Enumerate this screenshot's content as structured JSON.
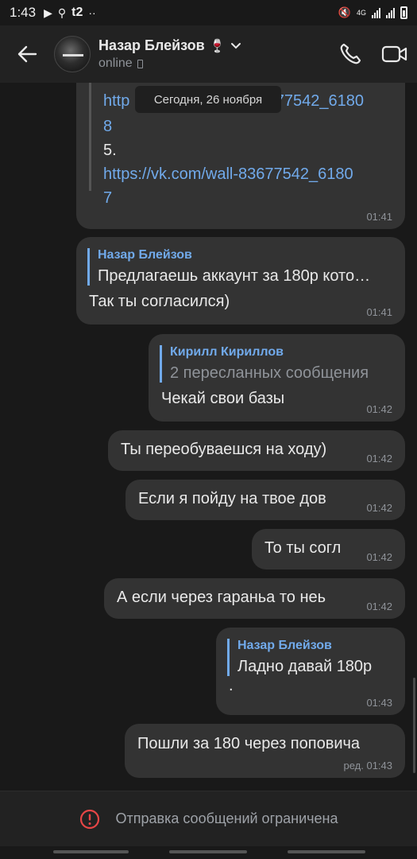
{
  "status_bar": {
    "time": "1:43",
    "carrier": "t2",
    "network": "4G",
    "dots": "··"
  },
  "header": {
    "contact_name": "Назар Блейзов",
    "emoji": "🍷",
    "status": "online"
  },
  "date_divider": "Сегодня, 26 ноября",
  "messages": [
    {
      "from": "them",
      "link_partial_1": "http",
      "link_partial_1b": "83677542_6180",
      "link_partial_2": "8",
      "list_num": "5.",
      "link_line_1": "https://vk.com/wall-83677542_6180",
      "link_line_2": "7",
      "time": "01:41"
    },
    {
      "from": "them",
      "reply_name": "Назар Блейзов",
      "reply_text": "Предлагаешь аккаунт за 180р кото…",
      "text": "Так ты согласился)",
      "time": "01:41"
    },
    {
      "from": "me",
      "reply_name": "Кирилл Кириллов",
      "reply_text": "2 пересланных сообщения",
      "text": "Чекай свои базы",
      "time": "01:42"
    },
    {
      "from": "me",
      "text": "Ты переобуваешся на ходу)",
      "time": "01:42"
    },
    {
      "from": "me",
      "text": "Если я пойду на твое дов",
      "time": "01:42"
    },
    {
      "from": "me",
      "text": "То ты согл",
      "time": "01:42"
    },
    {
      "from": "me",
      "text": "А если через гараньа то неь",
      "time": "01:42"
    },
    {
      "from": "me",
      "reply_name": "Назар Блейзов",
      "reply_text": "Ладно давай 180р",
      "text": ".",
      "time": "01:43"
    },
    {
      "from": "me",
      "text": "Пошли за 180 через поповича",
      "time": "ред. 01:43"
    }
  ],
  "restriction": {
    "text": "Отправка сообщений ограничена"
  },
  "colors": {
    "accent": "#71aaeb",
    "bubble": "#333333",
    "background": "#191919",
    "alert": "#e64646"
  }
}
